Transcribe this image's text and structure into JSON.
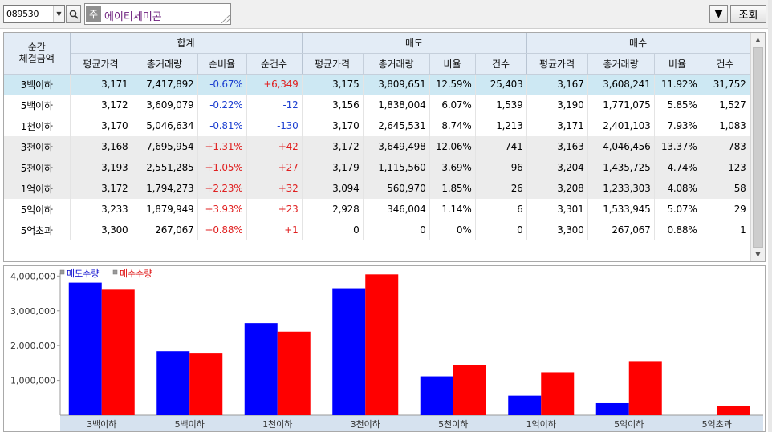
{
  "toolbar": {
    "stock_code": "089530",
    "stock_type_badge": "주",
    "stock_name": "에이티세미콘",
    "nav_glyph": "▼",
    "query_label": "조회"
  },
  "grid": {
    "header": {
      "category_label": "순간\n체결금액",
      "groups": [
        "합계",
        "매도",
        "매수"
      ],
      "columns": [
        "평균가격",
        "총거래량",
        "순비율",
        "순건수",
        "평균가격",
        "총거래량",
        "비율",
        "건수",
        "평균가격",
        "총거래량",
        "비율",
        "건수"
      ]
    },
    "rows": [
      {
        "cat": "3백이하",
        "style": "sel",
        "c": [
          "3,171",
          "7,417,892",
          "-0.67%",
          "+6,349",
          "3,175",
          "3,809,651",
          "12.59%",
          "25,403",
          "3,167",
          "3,608,241",
          "11.92%",
          "31,752"
        ]
      },
      {
        "cat": "5백이하",
        "style": "",
        "c": [
          "3,172",
          "3,609,079",
          "-0.22%",
          "-12",
          "3,156",
          "1,838,004",
          "6.07%",
          "1,539",
          "3,190",
          "1,771,075",
          "5.85%",
          "1,527"
        ]
      },
      {
        "cat": "1천이하",
        "style": "",
        "c": [
          "3,170",
          "5,046,634",
          "-0.81%",
          "-130",
          "3,170",
          "2,645,531",
          "8.74%",
          "1,213",
          "3,171",
          "2,401,103",
          "7.93%",
          "1,083"
        ]
      },
      {
        "cat": "3천이하",
        "style": "shade",
        "c": [
          "3,168",
          "7,695,954",
          "+1.31%",
          "+42",
          "3,172",
          "3,649,498",
          "12.06%",
          "741",
          "3,163",
          "4,046,456",
          "13.37%",
          "783"
        ]
      },
      {
        "cat": "5천이하",
        "style": "shade",
        "c": [
          "3,193",
          "2,551,285",
          "+1.05%",
          "+27",
          "3,179",
          "1,115,560",
          "3.69%",
          "96",
          "3,204",
          "1,435,725",
          "4.74%",
          "123"
        ]
      },
      {
        "cat": "1억이하",
        "style": "shade",
        "c": [
          "3,172",
          "1,794,273",
          "+2.23%",
          "+32",
          "3,094",
          "560,970",
          "1.85%",
          "26",
          "3,208",
          "1,233,303",
          "4.08%",
          "58"
        ]
      },
      {
        "cat": "5억이하",
        "style": "",
        "c": [
          "3,233",
          "1,879,949",
          "+3.93%",
          "+23",
          "2,928",
          "346,004",
          "1.14%",
          "6",
          "3,301",
          "1,533,945",
          "5.07%",
          "29"
        ]
      },
      {
        "cat": "5억초과",
        "style": "",
        "c": [
          "3,300",
          "267,067",
          "+0.88%",
          "+1",
          "0",
          "0",
          "0%",
          "0",
          "3,300",
          "267,067",
          "0.88%",
          "1"
        ]
      }
    ]
  },
  "colors": {
    "sell": "#0000ff",
    "buy": "#ff0000",
    "net_negative": "#1c3fd0",
    "net_positive": "#e02020"
  },
  "chart_data": {
    "type": "bar",
    "categories": [
      "3백이하",
      "5백이하",
      "1천이하",
      "3천이하",
      "5천이하",
      "1억이하",
      "5억이하",
      "5억초과"
    ],
    "series": [
      {
        "name": "매도수량",
        "color": "#0000ff",
        "values": [
          3809651,
          1838004,
          2645531,
          3649498,
          1115560,
          560970,
          346004,
          0
        ]
      },
      {
        "name": "매수수량",
        "color": "#ff0000",
        "values": [
          3608241,
          1771075,
          2401103,
          4046456,
          1435725,
          1233303,
          1533945,
          267067
        ]
      }
    ],
    "yticks": [
      1000000,
      2000000,
      3000000,
      4000000
    ],
    "ytick_labels": [
      "1,000,000",
      "2,000,000",
      "3,000,000",
      "4,000,000"
    ],
    "ylim": [
      0,
      4100000
    ],
    "legend_position": "top-left",
    "grid": false
  }
}
